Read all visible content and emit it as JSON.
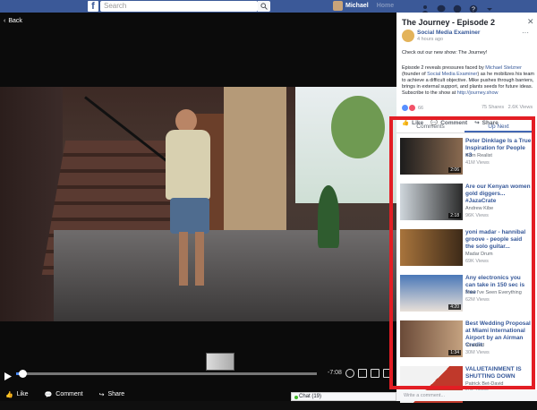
{
  "topbar": {
    "search_placeholder": "Search",
    "profile_name": "Michael",
    "home_label": "Home",
    "notification_count": "5"
  },
  "video": {
    "back_label": "Back",
    "time_remaining": "-7:08",
    "progress": 0.02,
    "actions": [
      {
        "label": "Like",
        "icon": "like-icon"
      },
      {
        "label": "Comment",
        "icon": "comment-icon"
      },
      {
        "label": "Share",
        "icon": "share-icon"
      }
    ]
  },
  "chat": {
    "label": "Chat (19)"
  },
  "post": {
    "title": "The Journey - Episode 2",
    "page_name": "Social Media Examiner",
    "time": "4 hours ago",
    "intro": "Check out our new show: The Journey!",
    "desc_a": "Episode 2 reveals pressures faced by ",
    "desc_name1": "Michael Stelzner",
    "desc_b": " (founder of ",
    "desc_name2": "Social Media Examiner",
    "desc_c": ") as he mobilizes his team to achieve a difficult objective. Mike pushes through barriers, brings in external support, and plants seeds for future ideas. Subscribe to the show at ",
    "desc_link": "http://journey.show",
    "reaction_count": "66",
    "shares": "75 Shares",
    "views": "2.6K Views",
    "actions": [
      "Like",
      "Comment",
      "Share"
    ],
    "comment_placeholder": "Write a comment..."
  },
  "tabs": {
    "comments": "Comments",
    "up_next": "Up Next"
  },
  "up_next": [
    {
      "title": "Peter Dinklage Is a True Inspiration for People <3",
      "author": "Born Realist",
      "views": "41M Views",
      "duration": "2:06",
      "colors": [
        "#1c1c1c",
        "#8a6a50"
      ]
    },
    {
      "title": "Are our Kenyan women gold diggers... #JazaCrate",
      "author": "Andrew Kibe",
      "views": "96K Views",
      "duration": "2:18",
      "colors": [
        "#cfd6dc",
        "#2a2a2a"
      ]
    },
    {
      "title": "yoni madar - hannibal groove - people said the solo guitar...",
      "author": "Madar Drum",
      "views": "69K Views",
      "duration": "",
      "colors": [
        "#a8743c",
        "#3d2a18"
      ]
    },
    {
      "title": "Any electronics you can take in 150 sec is free",
      "author": "Now I've Seen Everything",
      "views": "62M Views",
      "duration": "4:20",
      "colors": [
        "#4a78b8",
        "#e8e0d8"
      ]
    },
    {
      "title": "Best Wedding Proposal at Miami International Airport by an Airman Credit:",
      "author": "Viralized",
      "views": "30M Views",
      "duration": "1:34",
      "colors": [
        "#6a4a38",
        "#c5a280"
      ]
    },
    {
      "title": "VALUETAINMENT IS SHUTTING DOWN",
      "author": "Patrick Bet-David",
      "views": "50K Views",
      "duration": "",
      "colors": [
        "#f2f2f2",
        "#c0392b"
      ]
    }
  ],
  "accent": "#e31e24",
  "brand": "#3b5998"
}
